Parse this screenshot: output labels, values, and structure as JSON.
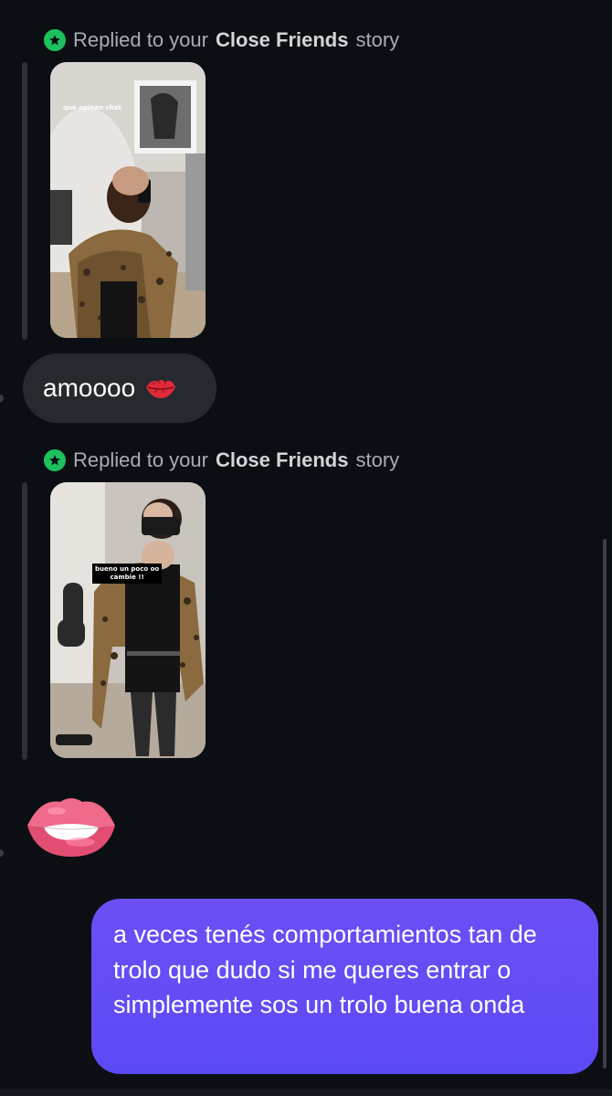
{
  "messages": [
    {
      "type": "story_reply",
      "header": {
        "prefix": "Replied to your",
        "highlight": "Close Friends",
        "suffix": "story"
      },
      "story_overlay_text": "que opinan chat"
    },
    {
      "type": "text_in",
      "text": "amoooo",
      "emoji": "kiss-mark-icon"
    },
    {
      "type": "story_reply",
      "header": {
        "prefix": "Replied to your",
        "highlight": "Close Friends",
        "suffix": "story"
      },
      "story_overlay_text_line1": "bueno un poco oo",
      "story_overlay_text_line2": "cambie !!"
    },
    {
      "type": "emoji_in",
      "emoji": "biting-lip-icon"
    },
    {
      "type": "text_out",
      "text": "a veces tenés comportamientos tan de trolo que dudo si me queres entrar o simplemente sos un trolo buena onda"
    }
  ],
  "colors": {
    "background": "#0b0f14",
    "incoming_bubble": "#26292e",
    "outgoing_bubble": "#5b4af4",
    "close_friends_green": "#1ec15f",
    "header_text": "#a9adb3"
  }
}
